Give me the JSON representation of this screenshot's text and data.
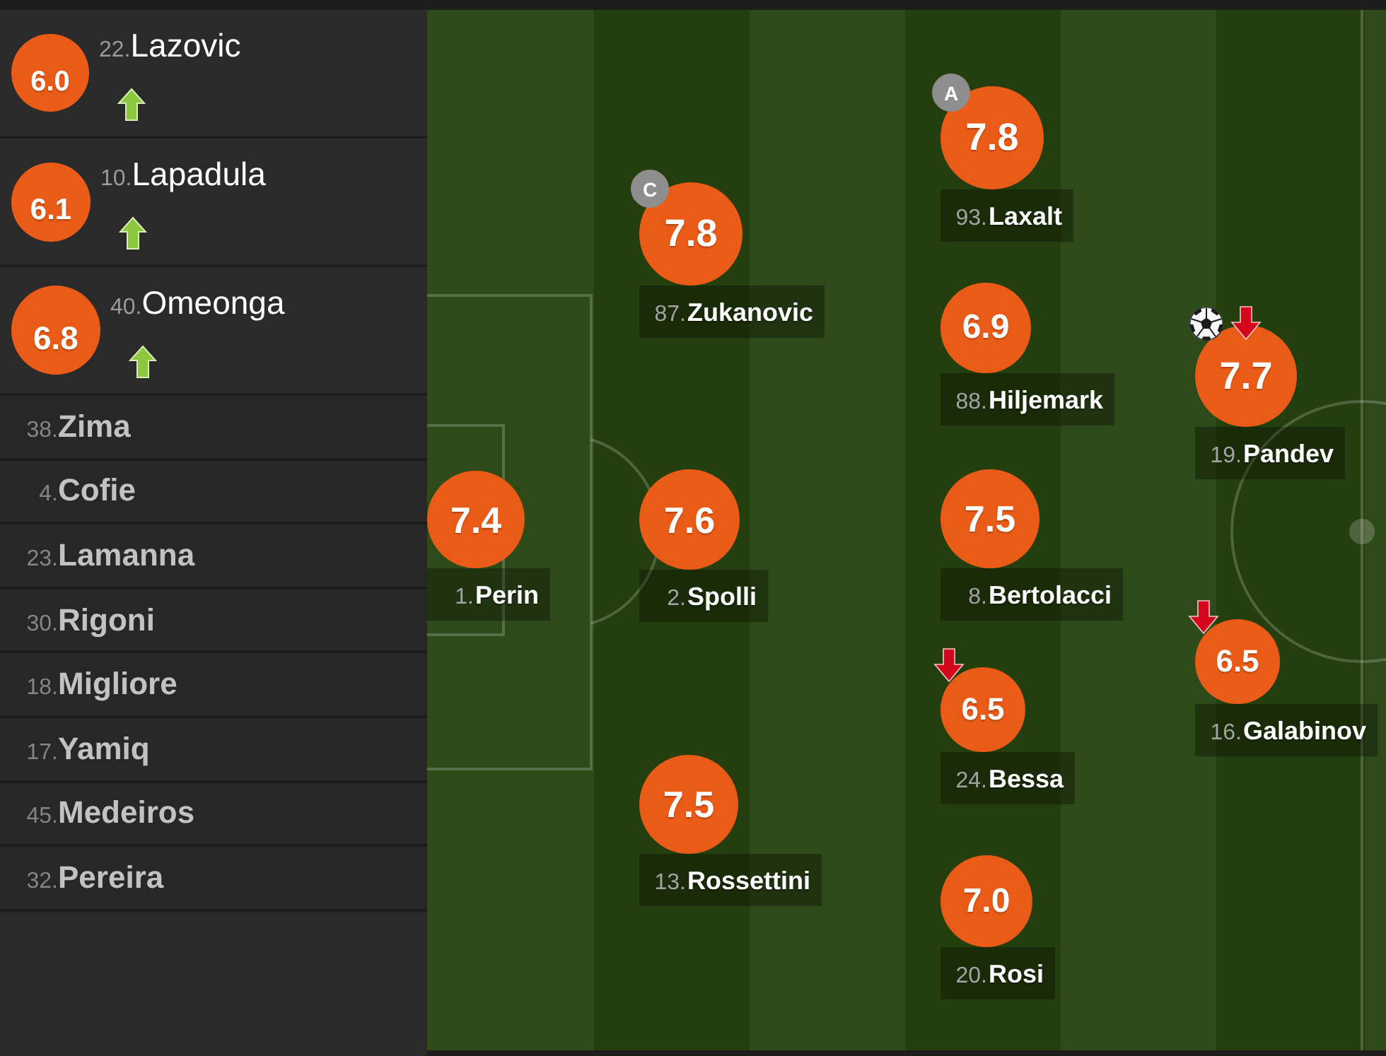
{
  "substitutes": [
    {
      "number": "22.",
      "name": "Lazovic",
      "rating": "6.0",
      "subbed_on": true
    },
    {
      "number": "10.",
      "name": "Lapadula",
      "rating": "6.1",
      "subbed_on": true
    },
    {
      "number": "40.",
      "name": "Omeonga",
      "rating": "6.8",
      "subbed_on": true
    }
  ],
  "bench": [
    {
      "number": "38.",
      "name": "Zima"
    },
    {
      "number": "4.",
      "name": "Cofie"
    },
    {
      "number": "23.",
      "name": "Lamanna"
    },
    {
      "number": "30.",
      "name": "Rigoni"
    },
    {
      "number": "18.",
      "name": "Migliore"
    },
    {
      "number": "17.",
      "name": "Yamiq"
    },
    {
      "number": "45.",
      "name": "Medeiros"
    },
    {
      "number": "32.",
      "name": "Pereira"
    }
  ],
  "pitch": {
    "lines": [
      {
        "players": [
          {
            "number": "1.",
            "name": "Perin",
            "rating": "7.4",
            "scored": false,
            "subbed_off": false
          }
        ]
      },
      {
        "players": [
          {
            "number": "87.",
            "name": "Zukanovic",
            "rating": "7.8",
            "badge": "C",
            "scored": false,
            "subbed_off": false
          },
          {
            "number": "2.",
            "name": "Spolli",
            "rating": "7.6",
            "scored": false,
            "subbed_off": false
          },
          {
            "number": "13.",
            "name": "Rossettini",
            "rating": "7.5",
            "scored": false,
            "subbed_off": false
          }
        ]
      },
      {
        "players": [
          {
            "number": "93.",
            "name": "Laxalt",
            "rating": "7.8",
            "badge": "A",
            "scored": false,
            "subbed_off": false
          },
          {
            "number": "88.",
            "name": "Hiljemark",
            "rating": "6.9",
            "scored": false,
            "subbed_off": false
          },
          {
            "number": "8.",
            "name": "Bertolacci",
            "rating": "7.5",
            "scored": false,
            "subbed_off": false
          },
          {
            "number": "24.",
            "name": "Bessa",
            "rating": "6.5",
            "scored": false,
            "subbed_off": true
          },
          {
            "number": "20.",
            "name": "Rosi",
            "rating": "7.0",
            "scored": false,
            "subbed_off": false
          }
        ]
      },
      {
        "players": [
          {
            "number": "19.",
            "name": "Pandev",
            "rating": "7.7",
            "scored": true,
            "subbed_off": true
          },
          {
            "number": "16.",
            "name": "Galabinov",
            "rating": "6.5",
            "scored": false,
            "subbed_off": true
          }
        ]
      }
    ]
  }
}
